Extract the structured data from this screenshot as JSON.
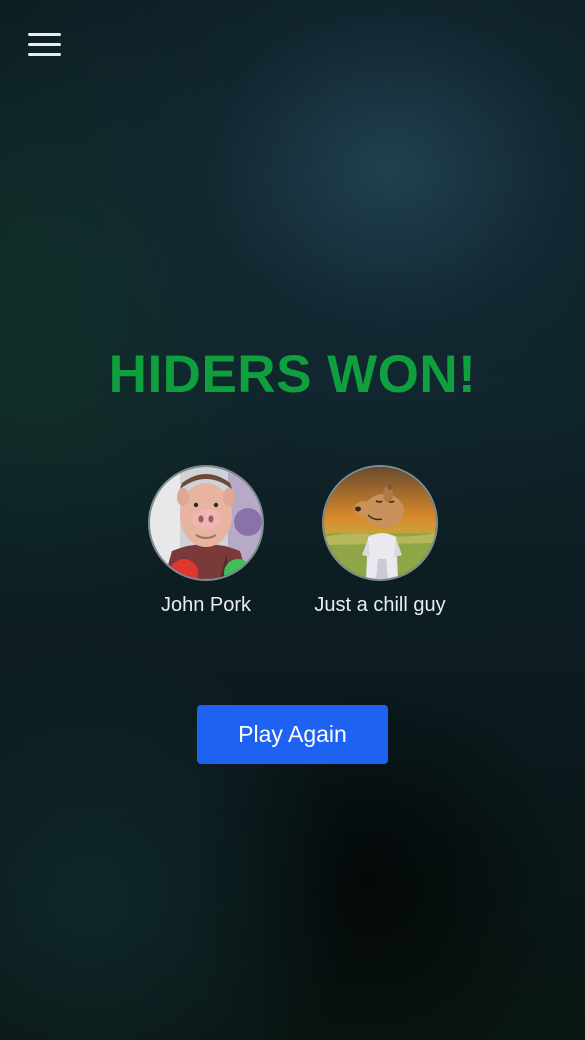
{
  "header": {
    "menu_icon": "hamburger-menu-icon"
  },
  "result": {
    "title": "HIDERS WON!",
    "title_color": "#0f9f3e"
  },
  "winners": [
    {
      "name": "John Pork",
      "avatar": "pig-man-photo"
    },
    {
      "name": "Just a chill guy",
      "avatar": "chill-guy-dog-cartoon"
    }
  ],
  "actions": {
    "play_again_label": "Play Again",
    "button_color": "#1d62f0"
  }
}
